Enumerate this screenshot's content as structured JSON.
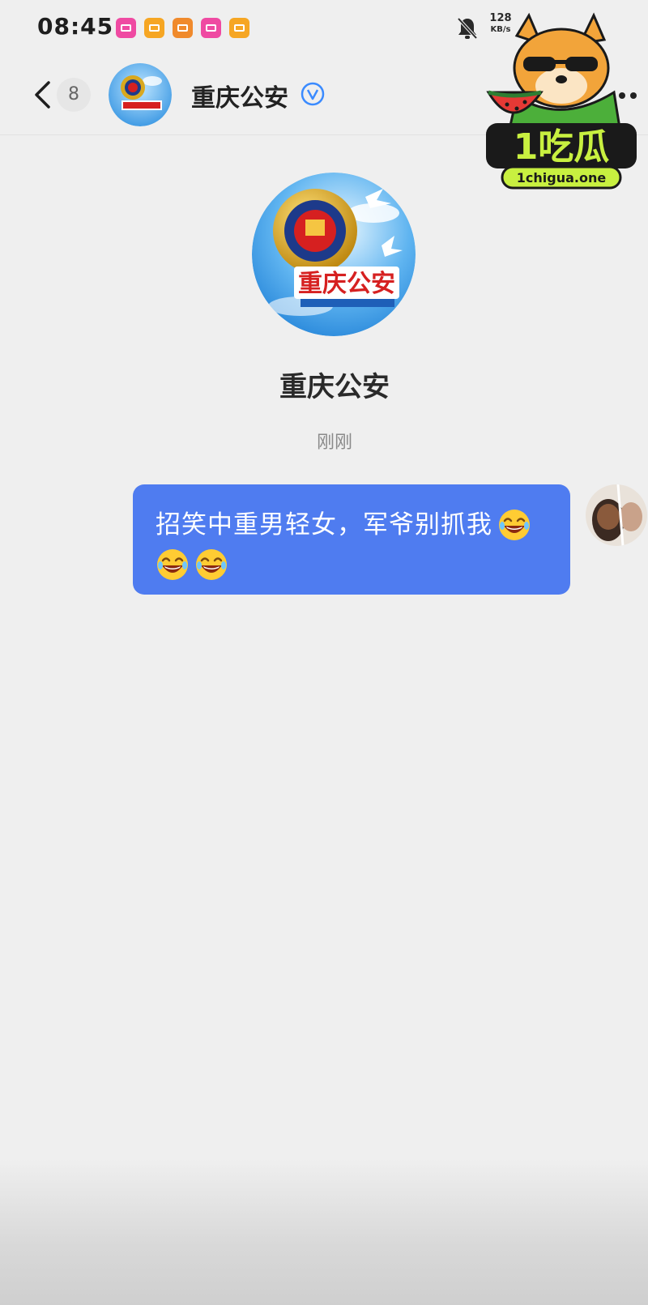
{
  "status_bar": {
    "time": "08:45",
    "net_speed_value": "128",
    "net_speed_unit": "KB/s"
  },
  "header": {
    "unread_count": "8",
    "title": "重庆公安"
  },
  "profile": {
    "name": "重庆公安",
    "avatar_text": "重庆公安"
  },
  "chat": {
    "timestamp": "刚刚",
    "message_text": "招笑中重男轻女，军爷别抓我"
  },
  "watermark": {
    "brand": "1吃瓜",
    "url": "1chigua.one"
  },
  "colors": {
    "bubble": "#4f7cf0",
    "verified": "#3b8bff",
    "background": "#efefef"
  },
  "icons": [
    "back-arrow-icon",
    "verified-icon",
    "more-icon",
    "bell-off-icon",
    "laughing-emoji-icon"
  ]
}
